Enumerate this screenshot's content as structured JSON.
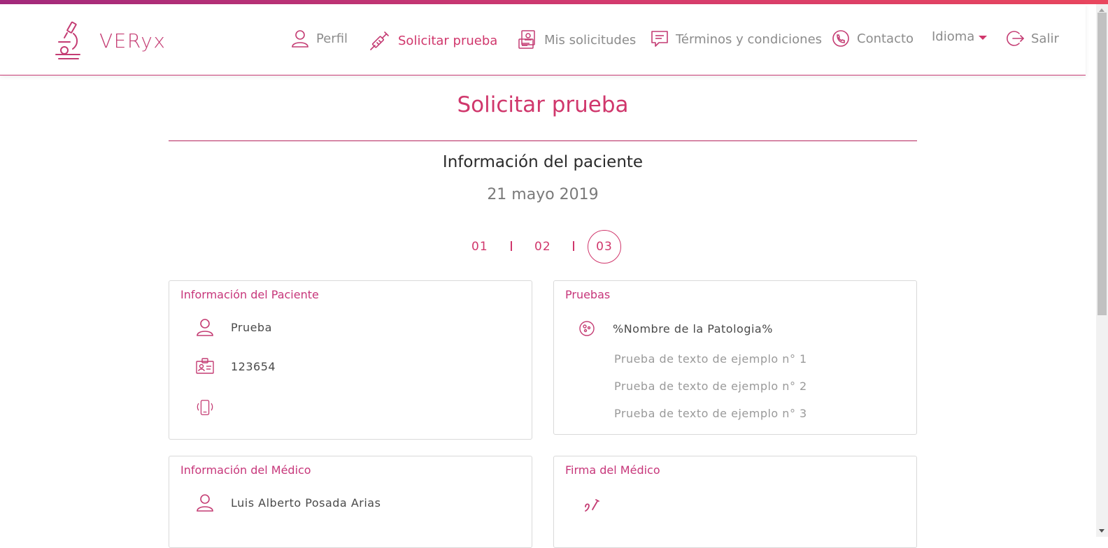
{
  "app": {
    "name": "VERyx"
  },
  "nav": {
    "perfil": "Perfil",
    "solicitar": "Solicitar prueba",
    "mis_solicitudes": "Mis solicitudes",
    "terminos": "Términos y condiciones",
    "contacto": "Contacto",
    "idioma": "Idioma",
    "salir": "Salir"
  },
  "page": {
    "title": "Solicitar prueba",
    "section": "Información del paciente",
    "date": "21 mayo 2019"
  },
  "steps": {
    "s1": "01",
    "s2": "02",
    "s3": "03",
    "current": 3
  },
  "patient": {
    "title": "Información del Paciente",
    "name": "Prueba",
    "id": "123654",
    "phone": ""
  },
  "tests": {
    "title": "Pruebas",
    "pathology": "%Nombre de la Patologia%",
    "items": [
      "Prueba de texto de ejemplo n° 1",
      "Prueba de texto de ejemplo n° 2",
      "Prueba de texto de ejemplo n° 3"
    ]
  },
  "doctor": {
    "title": "Información del Médico",
    "name": "Luis Alberto Posada Arias"
  },
  "signature": {
    "title": "Firma del Médico"
  },
  "colors": {
    "accent": "#d0376c",
    "brand": "#c43c73",
    "muted": "#8c8c8c"
  },
  "icons": [
    "microscope-icon",
    "user-icon",
    "syringe-icon",
    "requests-icon",
    "chat-icon",
    "phone-icon",
    "logout-icon",
    "id-card-icon",
    "mobile-icon",
    "pathology-icon",
    "pen-icon"
  ]
}
